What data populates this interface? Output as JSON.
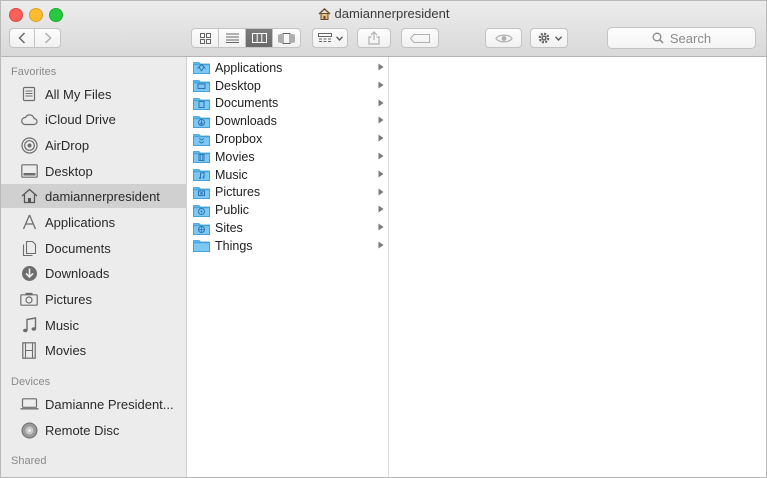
{
  "window": {
    "title": "damiannerpresident"
  },
  "toolbar": {
    "search_placeholder": "Search",
    "view_modes": [
      "icon-view",
      "list-view",
      "column-view",
      "cover-flow-view"
    ],
    "active_view": "column-view"
  },
  "sidebar": {
    "favorites_header": "Favorites",
    "favorites": [
      {
        "label": "All My Files",
        "icon": "all-files-icon"
      },
      {
        "label": "iCloud Drive",
        "icon": "cloud-icon"
      },
      {
        "label": "AirDrop",
        "icon": "airdrop-icon"
      },
      {
        "label": "Desktop",
        "icon": "desktop-icon"
      },
      {
        "label": "damiannerpresident",
        "icon": "home-icon"
      },
      {
        "label": "Applications",
        "icon": "applications-icon"
      },
      {
        "label": "Documents",
        "icon": "documents-icon"
      },
      {
        "label": "Downloads",
        "icon": "downloads-icon"
      },
      {
        "label": "Pictures",
        "icon": "camera-icon"
      },
      {
        "label": "Music",
        "icon": "music-note-icon"
      },
      {
        "label": "Movies",
        "icon": "film-icon"
      }
    ],
    "devices_header": "Devices",
    "devices": [
      {
        "label": "Damianne President...",
        "icon": "laptop-icon"
      },
      {
        "label": "Remote Disc",
        "icon": "disc-icon"
      }
    ],
    "shared_header": "Shared"
  },
  "column1": {
    "items": [
      {
        "label": "Applications",
        "icon": "folder-applications-icon"
      },
      {
        "label": "Desktop",
        "icon": "folder-desktop-icon"
      },
      {
        "label": "Documents",
        "icon": "folder-documents-icon"
      },
      {
        "label": "Downloads",
        "icon": "folder-downloads-icon"
      },
      {
        "label": "Dropbox",
        "icon": "folder-dropbox-icon"
      },
      {
        "label": "Movies",
        "icon": "folder-movies-icon"
      },
      {
        "label": "Music",
        "icon": "folder-music-icon"
      },
      {
        "label": "Pictures",
        "icon": "folder-pictures-icon"
      },
      {
        "label": "Public",
        "icon": "folder-public-icon"
      },
      {
        "label": "Sites",
        "icon": "folder-sites-icon"
      },
      {
        "label": "Things",
        "icon": "folder-icon"
      }
    ]
  },
  "colors": {
    "folder": "#5bb8ee",
    "selected_sidebar": "#d0d0d0"
  }
}
